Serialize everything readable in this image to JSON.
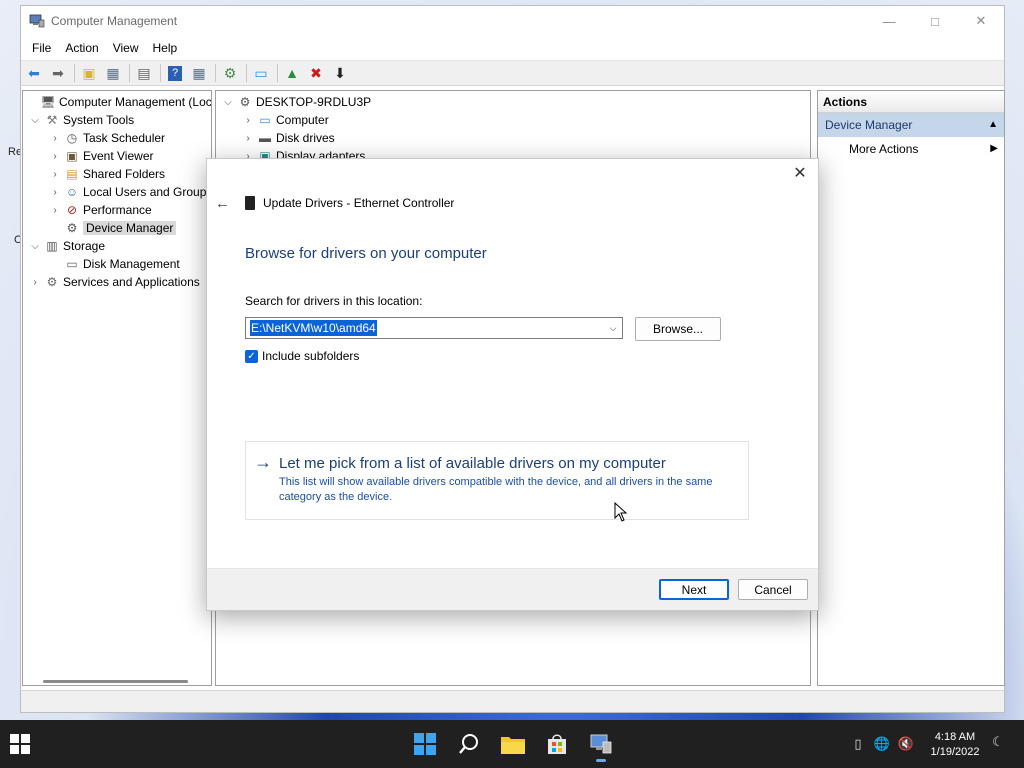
{
  "window": {
    "title": "Computer Management",
    "menu": [
      "File",
      "Action",
      "View",
      "Help"
    ]
  },
  "tree": {
    "root": "Computer Management (Local",
    "system_tools": "System Tools",
    "task_scheduler": "Task Scheduler",
    "event_viewer": "Event Viewer",
    "shared_folders": "Shared Folders",
    "local_users": "Local Users and Groups",
    "performance": "Performance",
    "device_manager": "Device Manager",
    "storage": "Storage",
    "disk_management": "Disk Management",
    "services": "Services and Applications"
  },
  "devices": {
    "root": "DESKTOP-9RDLU3P",
    "items": [
      "Computer",
      "Disk drives",
      "Display adapters"
    ]
  },
  "actions": {
    "header": "Actions",
    "section": "Device Manager",
    "more": "More Actions"
  },
  "dialog": {
    "header": "Update Drivers - Ethernet Controller",
    "heading": "Browse for drivers on your computer",
    "search_label": "Search for drivers in this location:",
    "path_value": "E:\\NetKVM\\w10\\amd64",
    "browse_label": "Browse...",
    "include_subfolders_label": "Include subfolders",
    "include_subfolders_checked": true,
    "pick_title": "Let me pick from a list of available drivers on my computer",
    "pick_desc": "This list will show available drivers compatible with the device, and all drivers in the same category as the device.",
    "next_label": "Next",
    "cancel_label": "Cancel"
  },
  "taskbar": {
    "time": "4:18 AM",
    "date": "1/19/2022"
  },
  "desktop_fragments": [
    "Re",
    "C"
  ],
  "colors": {
    "accent": "#0a64d8",
    "link": "#1c3f7a",
    "taskbar": "#202020",
    "actions_section": "#c6d6ea"
  }
}
